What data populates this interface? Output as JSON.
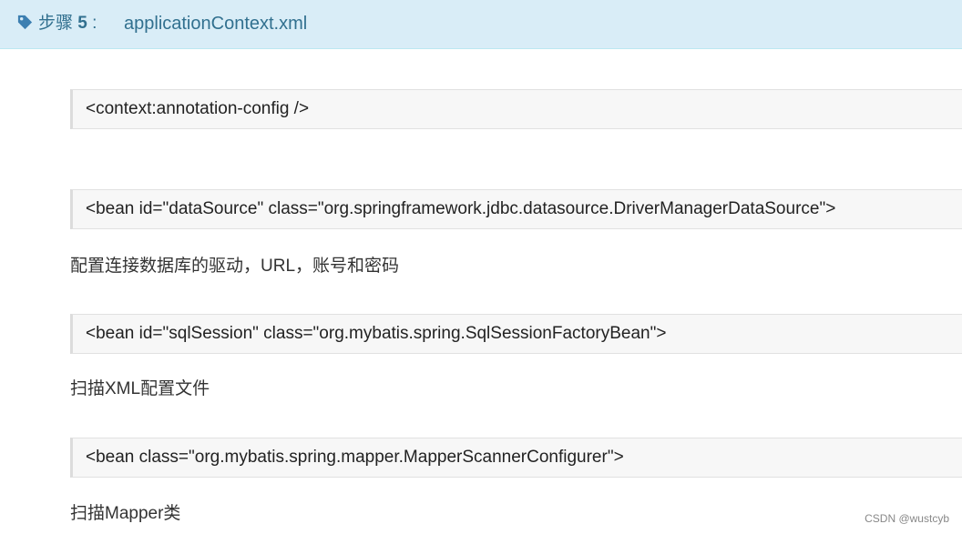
{
  "step": {
    "label_prefix": "步骤",
    "number": "5",
    "label_suffix": ":",
    "title": "applicationContext.xml",
    "tag_icon": "tag-icon",
    "accent_color": "#31708f",
    "bg_color": "#d9edf7"
  },
  "blocks": [
    {
      "code": "<context:annotation-config />",
      "desc": ""
    },
    {
      "code": "<bean id=\"dataSource\" class=\"org.springframework.jdbc.datasource.DriverManagerDataSource\">",
      "desc": "配置连接数据库的驱动，URL，账号和密码"
    },
    {
      "code": "<bean id=\"sqlSession\" class=\"org.mybatis.spring.SqlSessionFactoryBean\">",
      "desc": "扫描XML配置文件"
    },
    {
      "code": "<bean class=\"org.mybatis.spring.mapper.MapperScannerConfigurer\">",
      "desc": "扫描Mapper类"
    }
  ],
  "watermark": "CSDN @wustcyb"
}
